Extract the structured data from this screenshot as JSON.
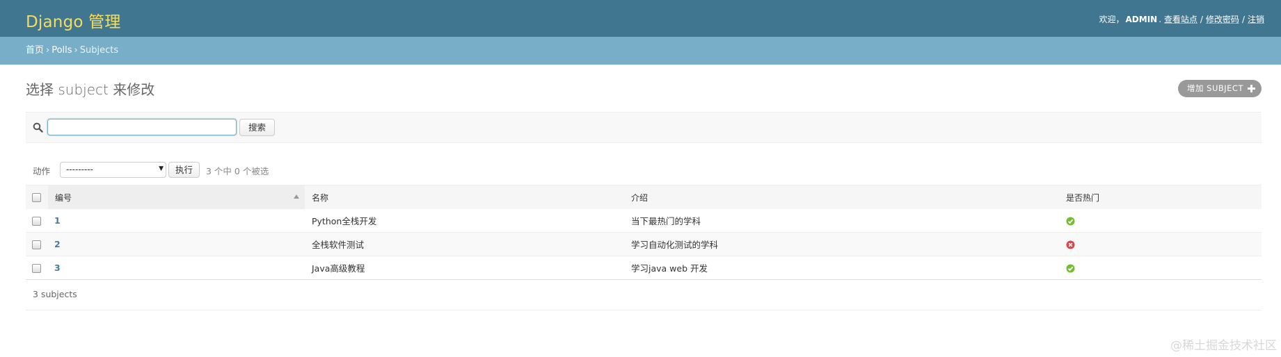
{
  "header": {
    "brand": "Django 管理",
    "welcome": "欢迎，",
    "username": "ADMIN",
    "links": [
      "查看站点",
      "修改密码",
      "注销"
    ],
    "separator": "/"
  },
  "breadcrumbs": {
    "home": "首页",
    "app": "Polls",
    "current": "Subjects",
    "arrow": "›"
  },
  "page": {
    "title": "选择 subject 来修改",
    "add_button": "增加 SUBJECT"
  },
  "search": {
    "value": "",
    "placeholder": "",
    "button": "搜索"
  },
  "actions": {
    "label": "动作",
    "selected": "---------",
    "go_button": "执行",
    "counter": "3 个中 0 个被选"
  },
  "table": {
    "columns": [
      "编号",
      "名称",
      "介绍",
      "是否热门"
    ],
    "sorted_column": "编号",
    "sort_direction": "ascending",
    "rows": [
      {
        "id": "1",
        "name": "Python全栈开发",
        "intro": "当下最热门的学科",
        "is_hot": true
      },
      {
        "id": "2",
        "name": "全栈软件测试",
        "intro": "学习自动化测试的学科",
        "is_hot": false
      },
      {
        "id": "3",
        "name": "Java高级教程",
        "intro": "学习java web 开发",
        "is_hot": true
      }
    ]
  },
  "paginator": {
    "text": "3 subjects"
  },
  "watermark": "@稀土掘金技术社区",
  "colors": {
    "header_bg": "#417690",
    "brand": "#f5dd5d",
    "breadcrumb_bg": "#79aec8",
    "link": "#447e9b",
    "yes_icon": "#70bf2b",
    "no_icon": "#dd4646",
    "add_button_bg": "#999999"
  }
}
